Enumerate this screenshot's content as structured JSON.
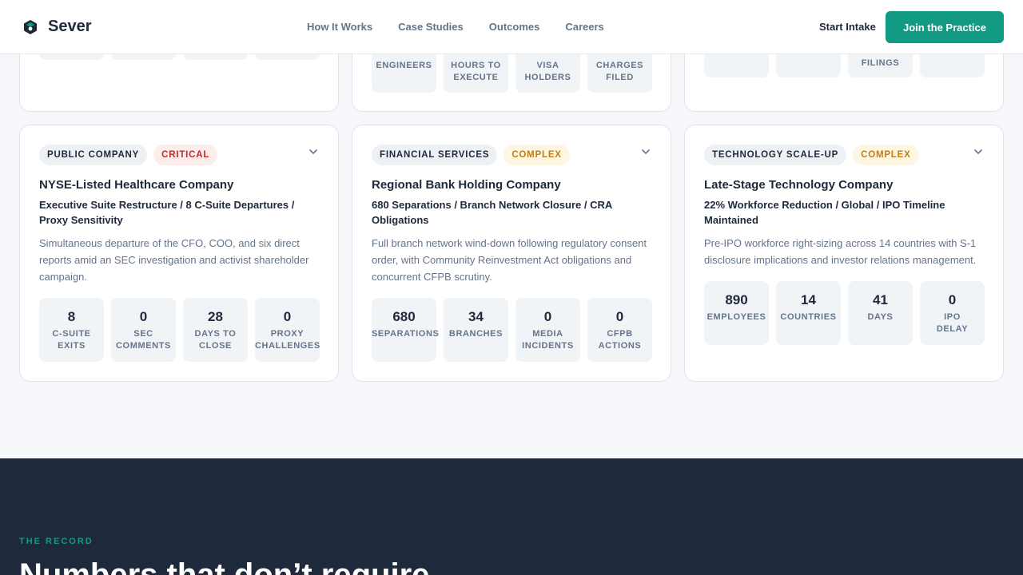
{
  "header": {
    "brand": "Sever",
    "nav": [
      "How It Works",
      "Case Studies",
      "Outcomes",
      "Careers"
    ],
    "start_label": "Start Intake",
    "join_label": "Join the Practice"
  },
  "colors": {
    "accent": "#139a85",
    "critical": "#c62828",
    "complex": "#c47d0e",
    "dark": "#1e2a3c"
  },
  "top_cards": [
    {
      "stats": []
    },
    {
      "stats": [
        {
          "label": "ENGINEERS"
        },
        {
          "label": "HOURS TO\nEXECUTE"
        },
        {
          "label": "VISA\nHOLDERS"
        },
        {
          "label": "CHARGES\nFILED"
        }
      ]
    },
    {
      "stats": [
        {
          "label": ""
        },
        {
          "label": ""
        },
        {
          "label": "FILINGS"
        },
        {
          "label": ""
        }
      ]
    }
  ],
  "cards": [
    {
      "category": "PUBLIC COMPANY",
      "severity": "CRITICAL",
      "title": "NYSE-Listed Healthcare Company",
      "subtitle": "Executive Suite Restructure / 8 C-Suite Departures / Proxy Sensitivity",
      "description": "Simultaneous departure of the CFO, COO, and six direct reports amid an SEC investigation and activist shareholder campaign.",
      "stats": [
        {
          "value": "8",
          "label": "C-SUITE\nEXITS"
        },
        {
          "value": "0",
          "label": "SEC\nCOMMENTS"
        },
        {
          "value": "28",
          "label": "DAYS TO\nCLOSE"
        },
        {
          "value": "0",
          "label": "PROXY\nCHALLENGES"
        }
      ]
    },
    {
      "category": "FINANCIAL SERVICES",
      "severity": "COMPLEX",
      "title": "Regional Bank Holding Company",
      "subtitle": "680 Separations / Branch Network Closure / CRA Obligations",
      "description": "Full branch network wind-down following regulatory consent order, with Community Reinvestment Act obligations and concurrent CFPB scrutiny.",
      "stats": [
        {
          "value": "680",
          "label": "SEPARATIONS"
        },
        {
          "value": "34",
          "label": "BRANCHES"
        },
        {
          "value": "0",
          "label": "MEDIA\nINCIDENTS"
        },
        {
          "value": "0",
          "label": "CFPB\nACTIONS"
        }
      ]
    },
    {
      "category": "TECHNOLOGY SCALE-UP",
      "severity": "COMPLEX",
      "title": "Late-Stage Technology Company",
      "subtitle": "22% Workforce Reduction / Global / IPO Timeline Maintained",
      "description": "Pre-IPO workforce right-sizing across 14 countries with S-1 disclosure implications and investor relations management.",
      "stats": [
        {
          "value": "890",
          "label": "EMPLOYEES"
        },
        {
          "value": "14",
          "label": "COUNTRIES"
        },
        {
          "value": "41",
          "label": "DAYS"
        },
        {
          "value": "0",
          "label": "IPO\nDELAY"
        }
      ]
    }
  ],
  "record": {
    "eyebrow": "THE RECORD",
    "heading": "Numbers that don’t require"
  }
}
